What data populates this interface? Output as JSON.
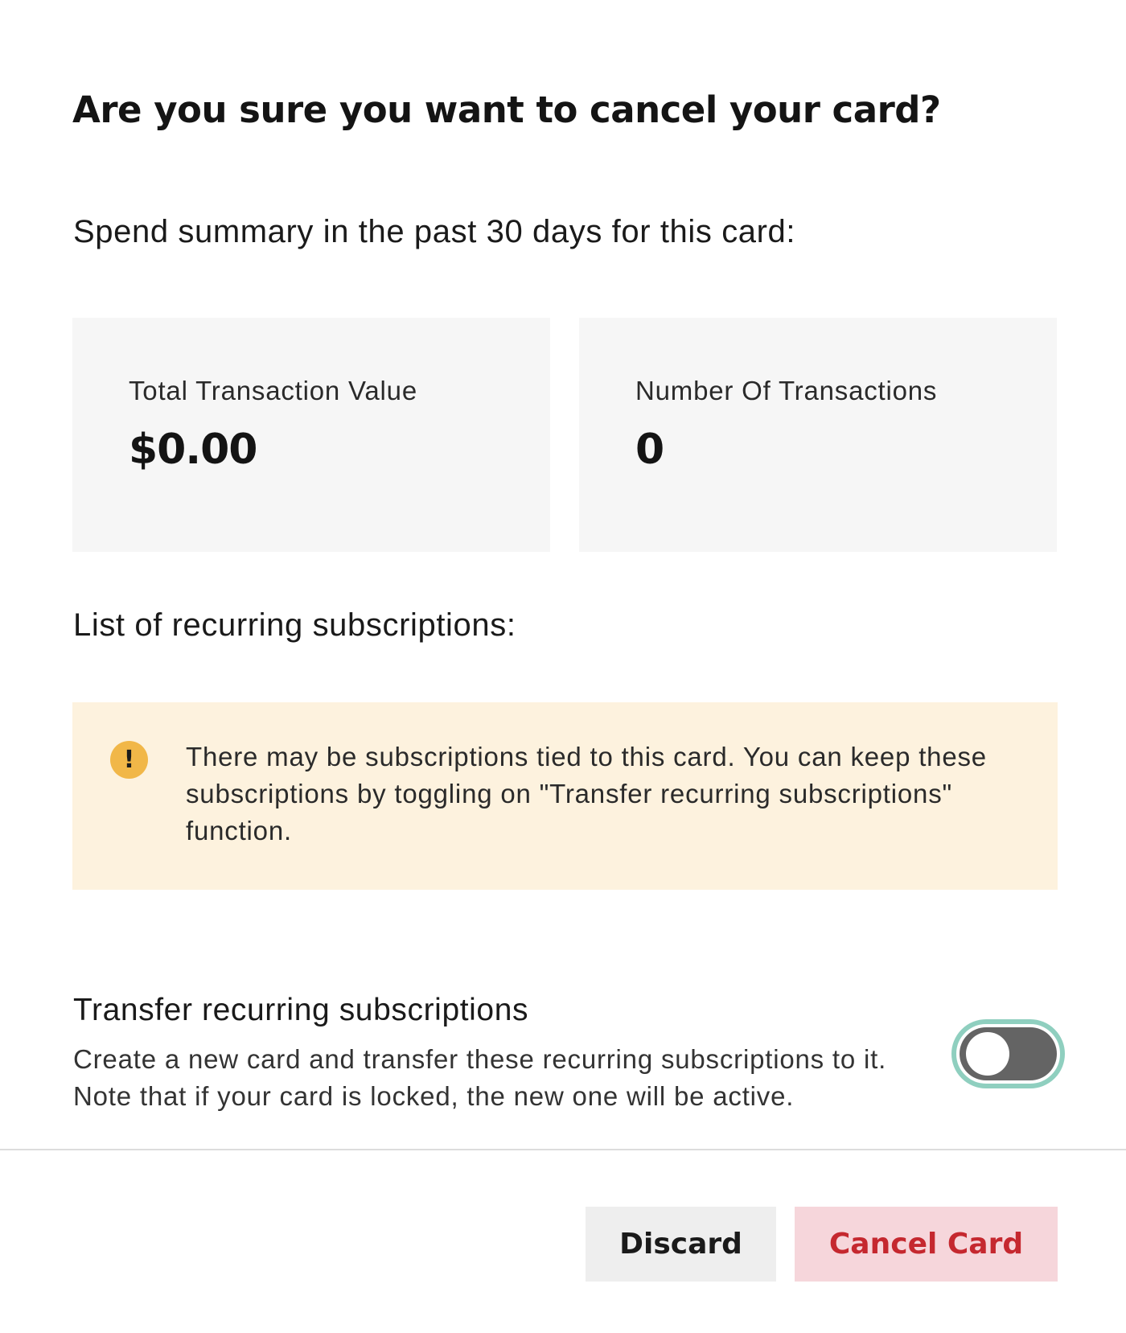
{
  "dialog": {
    "title": "Are you sure you want to cancel your card?",
    "summary_label": "Spend summary in the past 30 days for this card:",
    "stats": [
      {
        "label": "Total Transaction Value",
        "value": "$0.00"
      },
      {
        "label": "Number Of Transactions",
        "value": "0"
      }
    ],
    "subscriptions_label": "List of recurring subscriptions:",
    "notice": {
      "icon": "exclamation-icon",
      "icon_glyph": "!",
      "text": "There may be subscriptions tied to this card. You can keep these subscriptions by toggling on \"Transfer recurring subscriptions\" function."
    },
    "transfer": {
      "title": "Transfer recurring subscriptions",
      "description": "Create a new card and transfer these recurring subscriptions to it. Note that if your card is locked, the new one will be active.",
      "toggle_on": false
    },
    "buttons": {
      "discard": "Discard",
      "cancel_card": "Cancel Card"
    }
  },
  "colors": {
    "stat_card_bg": "#f6f6f6",
    "notice_bg": "#fdf2de",
    "notice_icon": "#f1b748",
    "toggle_track": "#646464",
    "toggle_focus_ring": "#8fcfbf",
    "discard_bg": "#eeeeee",
    "cancel_bg": "#f6d6db",
    "cancel_text": "#c5282f"
  }
}
